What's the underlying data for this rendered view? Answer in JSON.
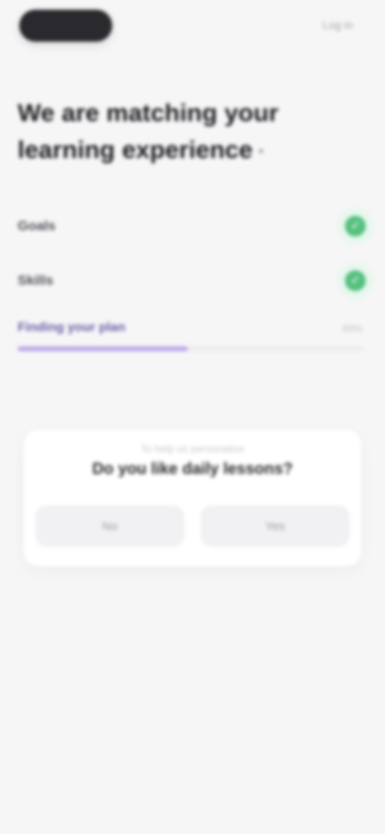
{
  "header": {
    "link_label": "Log in"
  },
  "main": {
    "title_line_1": "We are matching your",
    "title_line_2": "learning experience"
  },
  "checklist": {
    "items": [
      {
        "label": "Goals",
        "status_symbol": "✓"
      },
      {
        "label": "Skills",
        "status_symbol": "✓"
      }
    ],
    "progress": {
      "label": "Finding your plan",
      "percent_label": "49%",
      "value_percent": 49
    }
  },
  "card": {
    "caption": "To help us personalize",
    "question": "Do you like daily lessons?",
    "buttons": [
      {
        "label": "No"
      },
      {
        "label": "Yes"
      }
    ]
  },
  "colors": {
    "accent_green": "#56c07f",
    "accent_purple": "#b9a7e6",
    "background": "#f6f6f7"
  }
}
